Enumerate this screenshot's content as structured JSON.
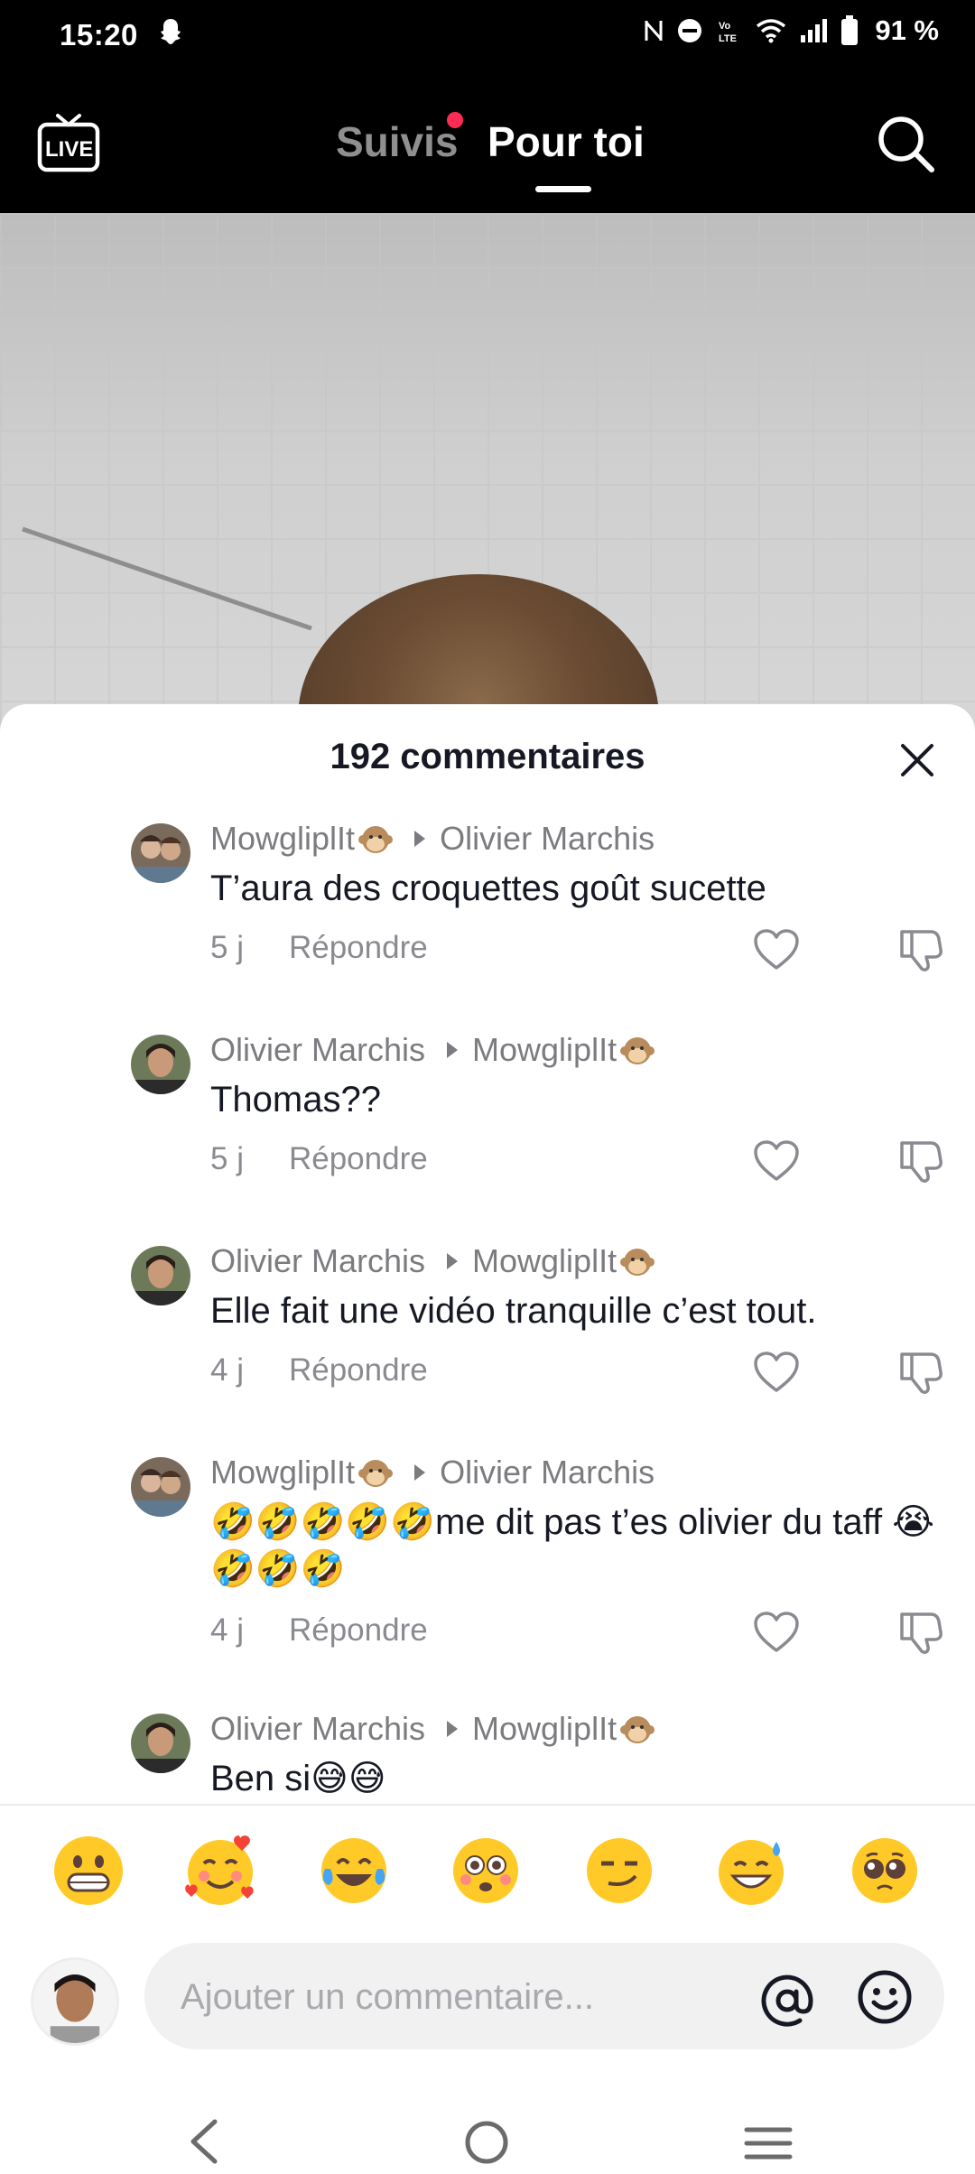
{
  "status_bar": {
    "time": "15:20",
    "battery_percent": "91 %"
  },
  "top_nav": {
    "tab_following": "Suivis",
    "tab_for_you": "Pour toi"
  },
  "comments_sheet": {
    "title": "192 commentaires",
    "comments": [
      {
        "author": "MowgliplIt",
        "author_emoji": "monkey-face",
        "reply_to": "Olivier Marchis",
        "text": "T’aura des croquettes goût sucette",
        "time": "5 j",
        "reply_label": "Répondre"
      },
      {
        "author": "Olivier Marchis",
        "reply_to": "MowgliplIt",
        "reply_to_emoji": "monkey-face",
        "text": "Thomas??",
        "time": "5 j",
        "reply_label": "Répondre"
      },
      {
        "author": "Olivier Marchis",
        "reply_to": "MowgliplIt",
        "reply_to_emoji": "monkey-face",
        "text": "Elle fait une vidéo tranquille c’est tout.",
        "time": "4 j",
        "reply_label": "Répondre"
      },
      {
        "author": "MowgliplIt",
        "author_emoji": "monkey-face",
        "reply_to": "Olivier Marchis",
        "text": "🤣🤣🤣🤣🤣me dit pas t’es olivier du taff 😭🤣🤣🤣",
        "time": "4 j",
        "reply_label": "Répondre"
      },
      {
        "author": "Olivier Marchis",
        "reply_to": "MowgliplIt",
        "reply_to_emoji": "monkey-face",
        "text": "Ben si😅😅"
      }
    ]
  },
  "emoji_bar": [
    "grinning-face",
    "smiling-face-with-hearts",
    "face-with-tears-of-joy",
    "flushed-face",
    "smirking-face",
    "grinning-sweat-face",
    "pleading-face"
  ],
  "comment_input": {
    "placeholder": "Ajouter un commentaire..."
  },
  "colors": {
    "accent": "#fe2c55",
    "text_primary": "#161823",
    "text_secondary": "#8a8b91"
  }
}
